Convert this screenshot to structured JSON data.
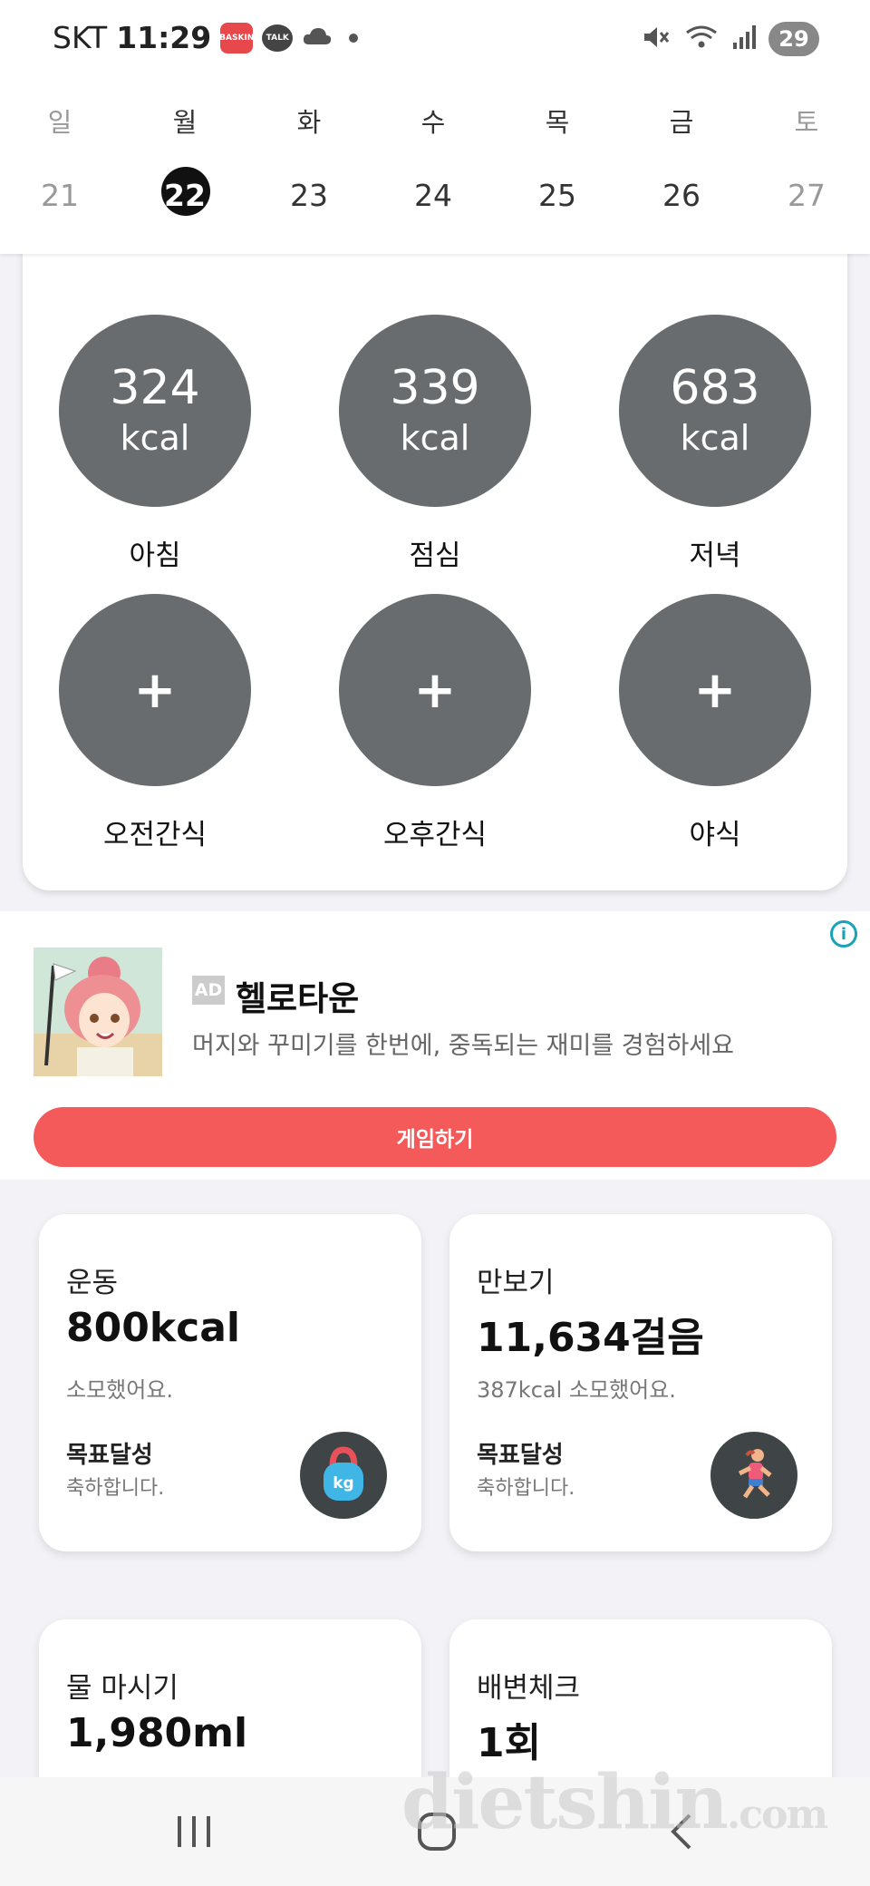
{
  "status_bar": {
    "carrier": "SKT",
    "time": "11:29",
    "app_badge": "BASKIN",
    "talk_badge": "TALK",
    "battery": "29"
  },
  "calendar": {
    "weekdays": [
      "일",
      "월",
      "화",
      "수",
      "목",
      "금",
      "토"
    ],
    "days": [
      "21",
      "22",
      "23",
      "24",
      "25",
      "26",
      "27"
    ],
    "selected_index": 1
  },
  "meals": [
    {
      "value": "324",
      "unit": "kcal",
      "label": "아침"
    },
    {
      "value": "339",
      "unit": "kcal",
      "label": "점심"
    },
    {
      "value": "683",
      "unit": "kcal",
      "label": "저녁"
    },
    {
      "plus": "+",
      "label": "오전간식"
    },
    {
      "plus": "+",
      "label": "오후간식"
    },
    {
      "plus": "+",
      "label": "야식"
    }
  ],
  "ad": {
    "badge": "AD",
    "title": "헬로타운",
    "description": "머지와 꾸미기를 한번에, 중독되는 재미를 경험하세요",
    "cta": "게임하기",
    "info": "i"
  },
  "cards": {
    "exercise": {
      "title": "운동",
      "value": "800kcal",
      "sub": "소모했어요.",
      "goal": "목표달성",
      "congrats": "축하합니다.",
      "icon": "kettlebell-icon",
      "icon_label": "kg"
    },
    "steps": {
      "title": "만보기",
      "value": "11,634걸음",
      "sub": "387kcal 소모했어요.",
      "goal": "목표달성",
      "congrats": "축하합니다.",
      "icon": "runner-icon"
    },
    "water": {
      "title": "물 마시기",
      "value": "1,980ml"
    },
    "bowel": {
      "title": "배변체크",
      "value": "1회"
    }
  },
  "watermark": {
    "main": "dietshin",
    "suffix": ".com"
  },
  "colors": {
    "meal_circle": "#686c6e",
    "cta": "#f45a5a",
    "ad_info": "#1aa3b8"
  }
}
